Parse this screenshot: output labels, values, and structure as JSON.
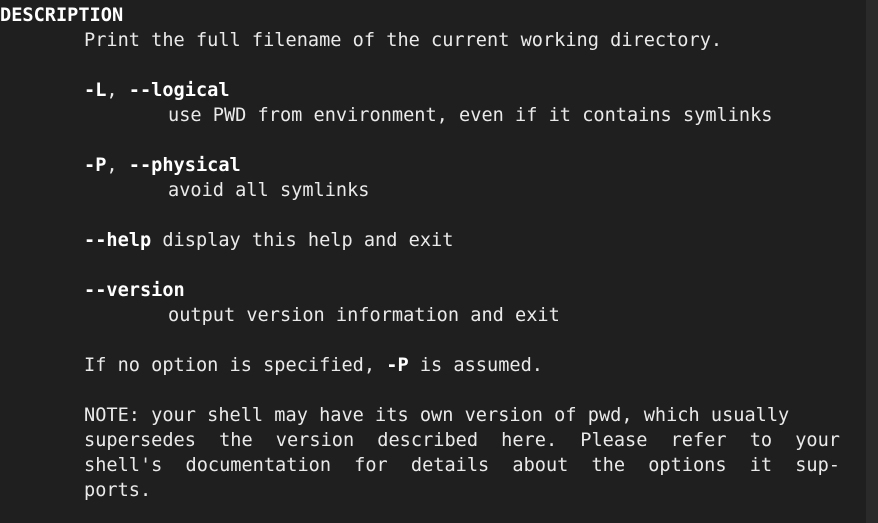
{
  "section": {
    "heading": "DESCRIPTION",
    "summary": "Print the full filename of the current working directory."
  },
  "options": {
    "logical": {
      "short": "-L",
      "sep": ", ",
      "long": "--logical",
      "desc": "use PWD from environment, even if it contains symlinks"
    },
    "physical": {
      "short": "-P",
      "sep": ", ",
      "long": "--physical",
      "desc": "avoid all symlinks"
    },
    "help": {
      "long": "--help",
      "desc": " display this help and exit"
    },
    "version": {
      "long": "--version",
      "desc": "output version information and exit"
    }
  },
  "default_note": {
    "before": "If no option is specified, ",
    "flag": "-P",
    "after": " is assumed."
  },
  "note": {
    "line1": "NOTE: your shell may have its own version of pwd, which usually",
    "line2_words": [
      "supersedes",
      "the",
      "version",
      "described",
      "here.",
      "Please",
      "refer",
      "to",
      "your"
    ],
    "line3_words": [
      "shell's",
      "documentation",
      "for",
      "details",
      "about",
      "the",
      "options",
      "it",
      "sup-"
    ],
    "line4": "ports."
  }
}
